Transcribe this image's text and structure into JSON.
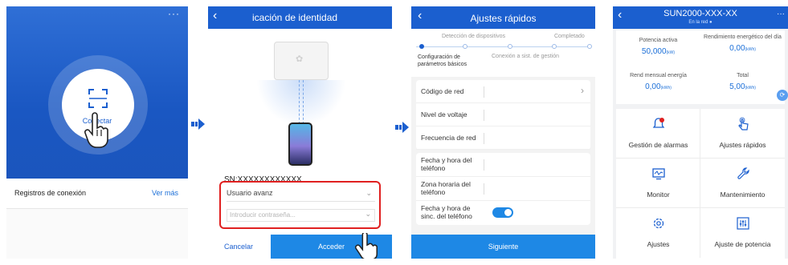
{
  "screen1": {
    "menu_dots": "···",
    "connect_label": "Conectar",
    "records_label": "Registros de conexión",
    "see_more": "Ver más"
  },
  "screen2": {
    "title": "icación de identidad",
    "back_icon": "‹",
    "device_logo": "✿",
    "sn": "SN:XXXXXXXXXXXX",
    "user_value": "Usuario avanz",
    "password_placeholder": "Introducir contraseña...",
    "cancel": "Cancelar",
    "accept": "Acceder"
  },
  "screen3": {
    "title": "Ajustes rápidos",
    "back_icon": "‹",
    "step_detect": "Detección de dispositivos",
    "step_done": "Completado",
    "step_config": "Configuración de parámetros básicos",
    "step_connect": "Conexión a sist. de gestión",
    "rows1": [
      "Código de red",
      "Nivel de voltaje",
      "Frecuencia de red"
    ],
    "rows2": [
      "Fecha y hora del teléfono",
      "Zona horaria del teléfono",
      "Fecha y hora de sinc. del teléfono"
    ],
    "next": "Siguiente"
  },
  "screen4": {
    "title": "SUN2000-XXX-XX",
    "subtitle": "En la red ●",
    "more": "···",
    "stats": [
      {
        "label": "Potencia activa",
        "value": "50,000",
        "unit": "(kW)"
      },
      {
        "label": "Rendimiento energético del día",
        "value": "0,00",
        "unit": "(kWh)"
      },
      {
        "label": "Rend mensual energía",
        "value": "0,00",
        "unit": "(kWh)"
      },
      {
        "label": "Total",
        "value": "5,00",
        "unit": "(kWh)"
      }
    ],
    "tiles": [
      "Gestión de alarmas",
      "Ajustes rápidos",
      "Monitor",
      "Mantenimiento",
      "Ajustes",
      "Ajuste de potencia"
    ]
  },
  "colors": {
    "primary": "#1b5fcf",
    "button": "#1e88e5",
    "highlight": "#e02020"
  }
}
